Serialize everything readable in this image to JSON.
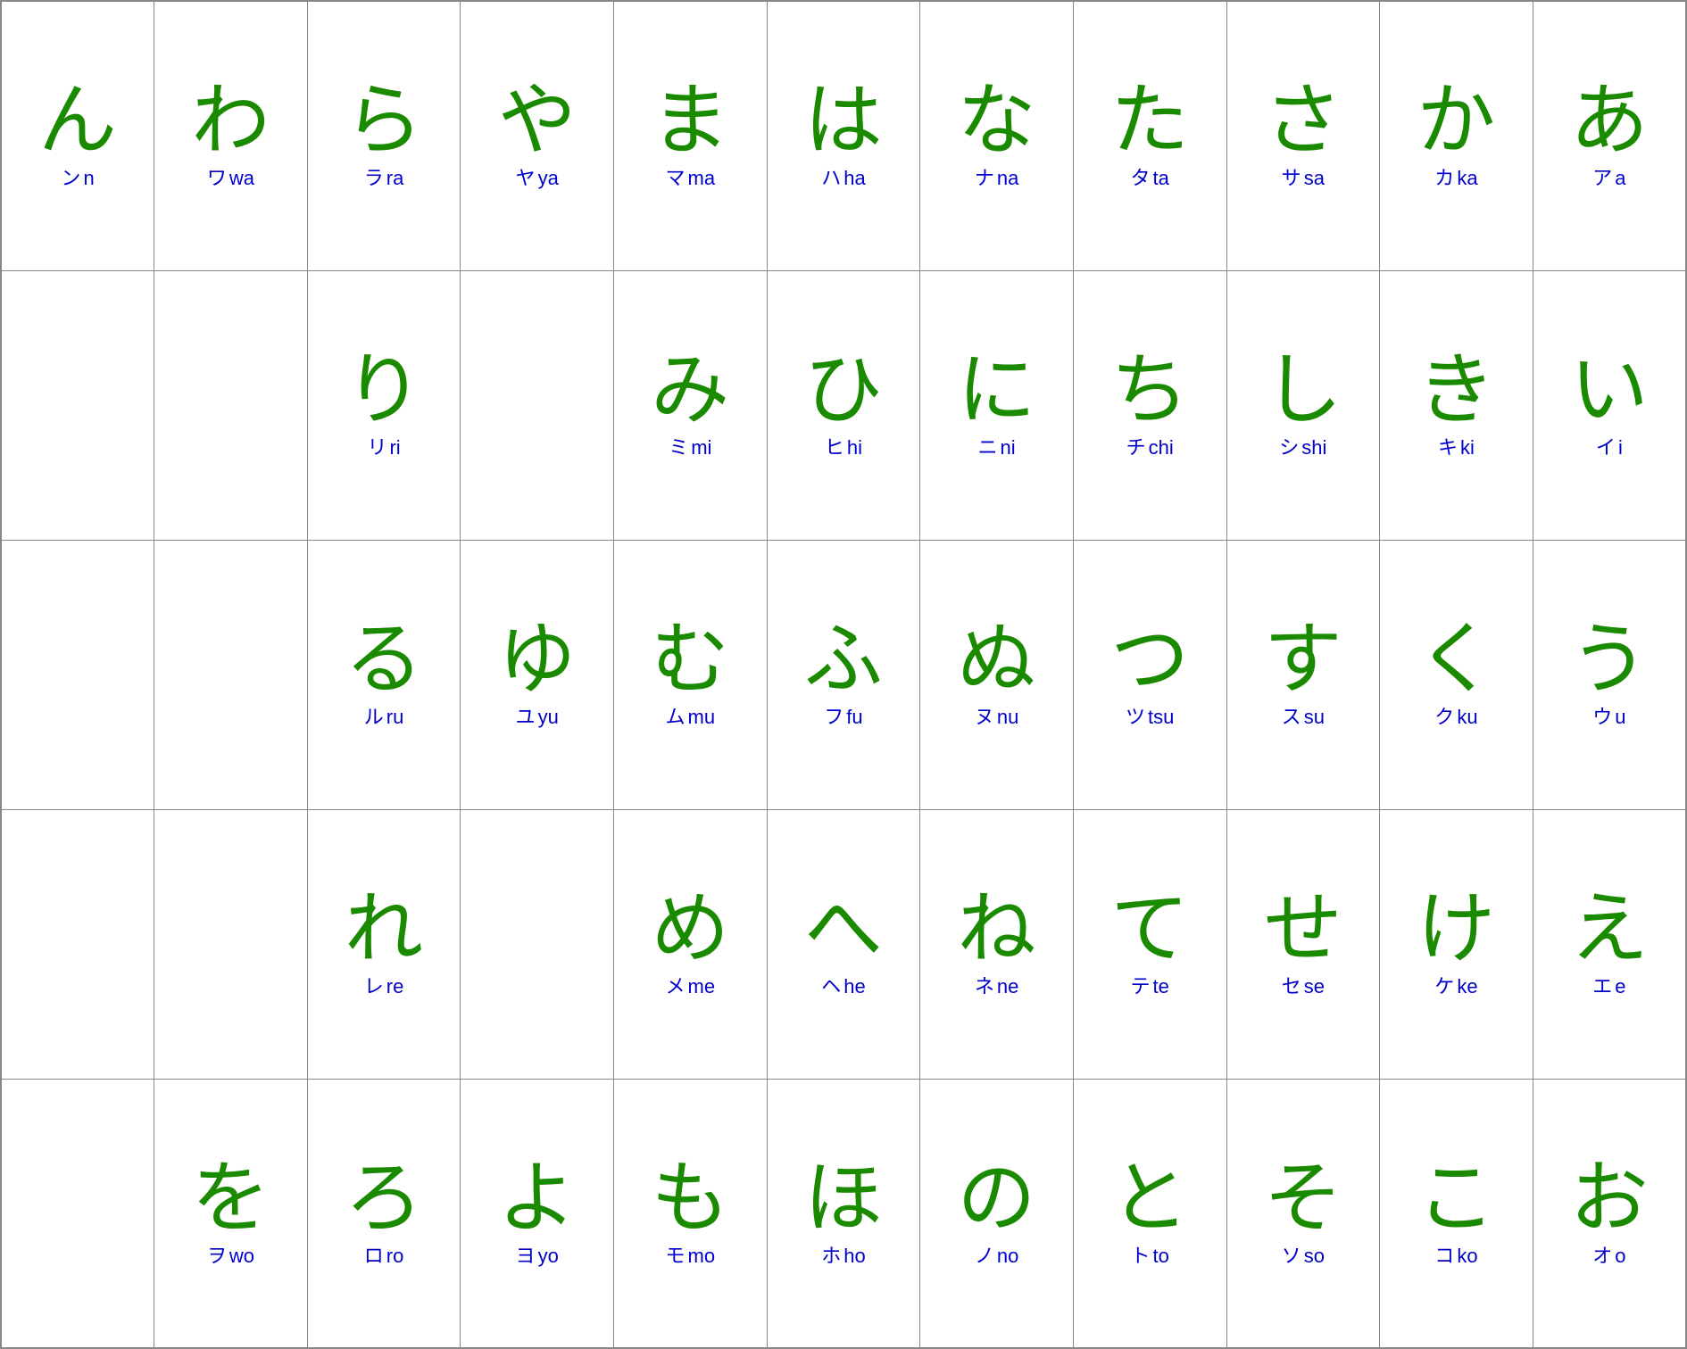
{
  "rows": [
    [
      {
        "hiragana": "ん",
        "katakana": "ン",
        "romaji": "n"
      },
      {
        "hiragana": "わ",
        "katakana": "ワ",
        "romaji": "wa"
      },
      {
        "hiragana": "ら",
        "katakana": "ラ",
        "romaji": "ra"
      },
      {
        "hiragana": "や",
        "katakana": "ヤ",
        "romaji": "ya"
      },
      {
        "hiragana": "ま",
        "katakana": "マ",
        "romaji": "ma"
      },
      {
        "hiragana": "は",
        "katakana": "ハ",
        "romaji": "ha"
      },
      {
        "hiragana": "な",
        "katakana": "ナ",
        "romaji": "na"
      },
      {
        "hiragana": "た",
        "katakana": "タ",
        "romaji": "ta"
      },
      {
        "hiragana": "さ",
        "katakana": "サ",
        "romaji": "sa"
      },
      {
        "hiragana": "か",
        "katakana": "カ",
        "romaji": "ka"
      },
      {
        "hiragana": "あ",
        "katakana": "ア",
        "romaji": "a"
      }
    ],
    [
      {
        "hiragana": "",
        "katakana": "",
        "romaji": ""
      },
      {
        "hiragana": "",
        "katakana": "",
        "romaji": ""
      },
      {
        "hiragana": "り",
        "katakana": "リ",
        "romaji": "ri"
      },
      {
        "hiragana": "",
        "katakana": "",
        "romaji": ""
      },
      {
        "hiragana": "み",
        "katakana": "ミ",
        "romaji": "mi"
      },
      {
        "hiragana": "ひ",
        "katakana": "ヒ",
        "romaji": "hi"
      },
      {
        "hiragana": "に",
        "katakana": "ニ",
        "romaji": "ni"
      },
      {
        "hiragana": "ち",
        "katakana": "チ",
        "romaji": "chi"
      },
      {
        "hiragana": "し",
        "katakana": "シ",
        "romaji": "shi"
      },
      {
        "hiragana": "き",
        "katakana": "キ",
        "romaji": "ki"
      },
      {
        "hiragana": "い",
        "katakana": "イ",
        "romaji": "i"
      }
    ],
    [
      {
        "hiragana": "",
        "katakana": "",
        "romaji": ""
      },
      {
        "hiragana": "",
        "katakana": "",
        "romaji": ""
      },
      {
        "hiragana": "る",
        "katakana": "ル",
        "romaji": "ru"
      },
      {
        "hiragana": "ゆ",
        "katakana": "ユ",
        "romaji": "yu"
      },
      {
        "hiragana": "む",
        "katakana": "ム",
        "romaji": "mu"
      },
      {
        "hiragana": "ふ",
        "katakana": "フ",
        "romaji": "fu"
      },
      {
        "hiragana": "ぬ",
        "katakana": "ヌ",
        "romaji": "nu"
      },
      {
        "hiragana": "つ",
        "katakana": "ツ",
        "romaji": "tsu"
      },
      {
        "hiragana": "す",
        "katakana": "ス",
        "romaji": "su"
      },
      {
        "hiragana": "く",
        "katakana": "ク",
        "romaji": "ku"
      },
      {
        "hiragana": "う",
        "katakana": "ウ",
        "romaji": "u"
      }
    ],
    [
      {
        "hiragana": "",
        "katakana": "",
        "romaji": ""
      },
      {
        "hiragana": "",
        "katakana": "",
        "romaji": ""
      },
      {
        "hiragana": "れ",
        "katakana": "レ",
        "romaji": "re"
      },
      {
        "hiragana": "",
        "katakana": "",
        "romaji": ""
      },
      {
        "hiragana": "め",
        "katakana": "メ",
        "romaji": "me"
      },
      {
        "hiragana": "へ",
        "katakana": "ヘ",
        "romaji": "he"
      },
      {
        "hiragana": "ね",
        "katakana": "ネ",
        "romaji": "ne"
      },
      {
        "hiragana": "て",
        "katakana": "テ",
        "romaji": "te"
      },
      {
        "hiragana": "せ",
        "katakana": "セ",
        "romaji": "se"
      },
      {
        "hiragana": "け",
        "katakana": "ケ",
        "romaji": "ke"
      },
      {
        "hiragana": "え",
        "katakana": "エ",
        "romaji": "e"
      }
    ],
    [
      {
        "hiragana": "",
        "katakana": "",
        "romaji": ""
      },
      {
        "hiragana": "を",
        "katakana": "ヲ",
        "romaji": "wo"
      },
      {
        "hiragana": "ろ",
        "katakana": "ロ",
        "romaji": "ro"
      },
      {
        "hiragana": "よ",
        "katakana": "ヨ",
        "romaji": "yo"
      },
      {
        "hiragana": "も",
        "katakana": "モ",
        "romaji": "mo"
      },
      {
        "hiragana": "ほ",
        "katakana": "ホ",
        "romaji": "ho"
      },
      {
        "hiragana": "の",
        "katakana": "ノ",
        "romaji": "no"
      },
      {
        "hiragana": "と",
        "katakana": "ト",
        "romaji": "to"
      },
      {
        "hiragana": "そ",
        "katakana": "ソ",
        "romaji": "so"
      },
      {
        "hiragana": "こ",
        "katakana": "コ",
        "romaji": "ko"
      },
      {
        "hiragana": "お",
        "katakana": "オ",
        "romaji": "o"
      }
    ]
  ]
}
